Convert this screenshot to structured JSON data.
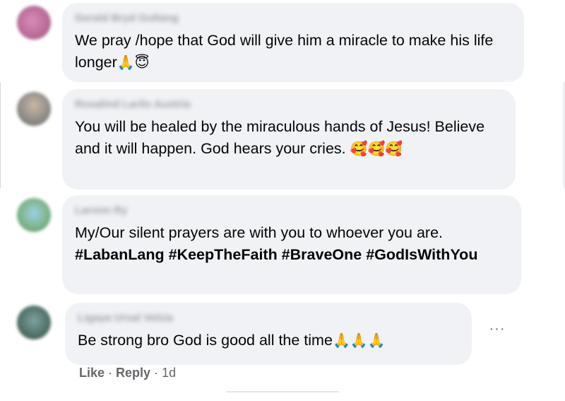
{
  "comments": [
    {
      "author": "Gerald Bryd Gultang",
      "text": "We pray /hope that God will give him a miracle to make his life longer",
      "emoji": "🙏😇"
    },
    {
      "author": "Rosalind Larilo Austria",
      "text": "You will be healed by the miraculous hands of Jesus! Believe and it will happen. God hears your cries.",
      "emoji": "🥰🥰🥰"
    },
    {
      "author": "Laronn Ry",
      "text": "My/Our silent prayers are with you to whoever you are.",
      "hashtags": "#LabanLang #KeepTheFaith #BraveOne #GodIsWithYou"
    },
    {
      "author": "Ligaya Ursal Velzia",
      "text": "Be strong bro God is good all the time",
      "emoji": "🙏🙏🙏"
    }
  ],
  "more_options": "···",
  "actions": {
    "like": "Like",
    "separator": "·",
    "reply": "Reply",
    "time": "1d"
  },
  "colors": {
    "bubble": "#f0f2f5",
    "meta_text": "#65676b",
    "text": "#050505"
  }
}
